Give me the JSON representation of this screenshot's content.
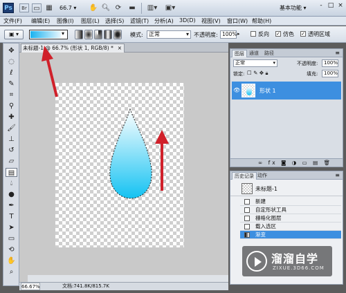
{
  "app": {
    "logo": "Ps",
    "zoom_dropdown": "66.7",
    "workspace": "基本功能",
    "window_controls": [
      "-",
      "□",
      "×"
    ]
  },
  "menu": [
    "文件(F)",
    "编辑(E)",
    "图像(I)",
    "图层(L)",
    "选择(S)",
    "滤镜(T)",
    "分析(A)",
    "3D(D)",
    "视图(V)",
    "窗口(W)",
    "帮助(H)"
  ],
  "options": {
    "mode_label": "模式:",
    "mode_value": "正常",
    "opacity_label": "不透明度:",
    "opacity_value": "100%",
    "reverse_label": "反向",
    "dither_label": "仿色",
    "transparency_label": "透明区域",
    "gradient_colors": [
      "#1ab2f0",
      "#e9f7fd"
    ]
  },
  "document": {
    "tab_title": "未标题-1 @ 66.7% (形状 1, RGB/8) *",
    "tab_close": "×",
    "zoom_status": "66.67%",
    "doc_status": "文档:741.8K/815.7K"
  },
  "layers": {
    "tabs": [
      "图层",
      "通道",
      "路径"
    ],
    "blend_mode": "正常",
    "opacity_label": "不透明度:",
    "opacity_value": "100%",
    "lock_label": "锁定:",
    "fill_label": "填充:",
    "fill_value": "100%",
    "layer_name": "形状 1"
  },
  "history": {
    "tabs": [
      "历史记录",
      "动作"
    ],
    "snapshot": "未标题-1",
    "items": [
      "新建",
      "自定形状工具",
      "栅格化图层",
      "载入选区",
      "渐变"
    ]
  },
  "watermark": {
    "brand": "溜溜自学",
    "url": "ZIXUE.3D66.COM"
  },
  "colors": {
    "selection": "#3d8fe0",
    "arrow": "#d0202a",
    "drop_top": "#ffffff",
    "drop_bottom": "#14c2f2"
  }
}
